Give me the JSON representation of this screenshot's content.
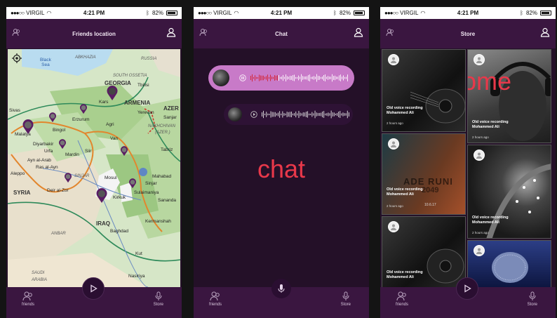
{
  "status": {
    "carrier": "VIRGIL",
    "time": "4:21 PM",
    "battery": "82%"
  },
  "screens": {
    "friends": {
      "title": "Friends location"
    },
    "chat": {
      "title": "Chat",
      "overlay_label": "chat"
    },
    "store": {
      "title": "Store",
      "overlay_label": "home"
    }
  },
  "tabbar": {
    "friends_label": "friends",
    "store_label": "Store"
  },
  "map": {
    "labels": {
      "black_sea": "Black\nSea",
      "abkhazia": "ABKHAZIA",
      "russia": "RUSSIA",
      "south_ossetia": "SOUTH OSSETIA",
      "georgia": "GEORGIA",
      "tbilisi": "Tbilisi",
      "kars": "Kars",
      "armenia": "ARMENIA",
      "azer": "AZER",
      "yerevan": "Yerevan",
      "sivas": "Sivas",
      "erzurum": "Erzurum",
      "agri": "Agri",
      "nakhchivan": "NAKHCHIVAN",
      "azer2": "(AZER.)",
      "bingol": "Bingol",
      "malatya": "Malatya",
      "diyarbakir": "Diyarbakir",
      "van": "Van",
      "tabriz": "Tabriz",
      "urfa": "Urfa",
      "mardin": "Mardin",
      "siirt": "Siir",
      "ayn_al_arab": "Ayn al-Arab",
      "ras_al_ayn": "Ras al-Ayn",
      "sinjar": "SINJAR",
      "mosul": "Mosul",
      "mahabad": "Mahabad",
      "aleppo": "Aleppo",
      "syria": "SYRIA",
      "deir": "Deir al-Zor",
      "sulaimaniya": "Sulaimaniya",
      "sinjar2": "Sinjar",
      "kirkuk": "Kirkuk",
      "sanandaj": "Sananda",
      "iraq": "IRAQ",
      "baghdad": "Baghdad",
      "kermanshah": "Kermanshah",
      "anbar": "ANBAR",
      "kut": "Kut",
      "saudi": "SAUDI",
      "arabia": "ARABIA",
      "nasiriya": "Nasiriya",
      "sanjar": "Sanjar"
    }
  },
  "store_items": [
    {
      "title_line1": "Old voice recording",
      "title_line2": "Mohammed Ali",
      "time": "2 hours ago"
    },
    {
      "title_line1": "Old voice recording",
      "title_line2": "Mohammed Ali",
      "time": "2 hours ago"
    },
    {
      "title_line1": "Old voice recording",
      "title_line2": "Mohammed Ali",
      "time": "2 hours ago"
    },
    {
      "title_line1": "Old voice recording",
      "title_line2": "Mohammed Ali",
      "time": "2 hours ago"
    },
    {
      "title_line1": "Old voice recording",
      "title_line2": "Mohammed Ali",
      "time": "2 hours ago"
    }
  ],
  "poster_text": {
    "line1": "ADE RUNI",
    "line2": "2049",
    "line3": "10.6.17"
  },
  "colors": {
    "accent": "#3a1640",
    "overlay_text": "#e8384a",
    "bubble": "#c87ac8"
  },
  "icons": [
    "users-icon",
    "profile-icon",
    "play-icon",
    "microphone-icon",
    "locate-target-icon",
    "pause-icon"
  ]
}
